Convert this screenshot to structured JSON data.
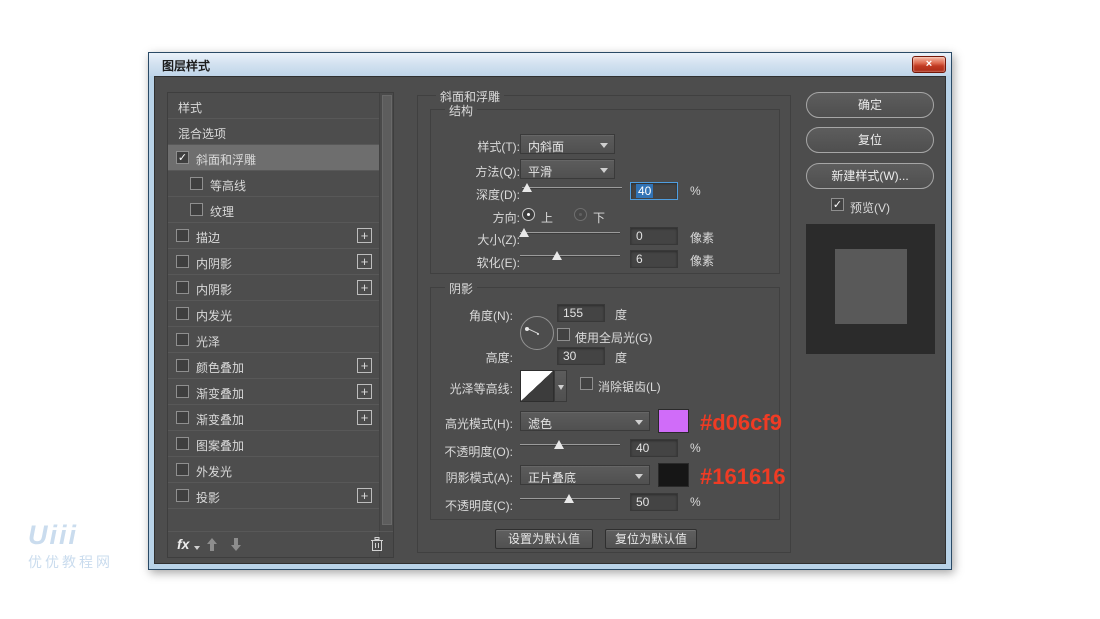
{
  "window": {
    "title": "图层样式",
    "close_label": "×"
  },
  "sidebar": {
    "items": [
      {
        "key": "styles",
        "label": "样式",
        "checkbox": false
      },
      {
        "key": "blending-options",
        "label": "混合选项",
        "checkbox": false
      },
      {
        "key": "bevel-emboss",
        "label": "斜面和浮雕",
        "checkbox": true,
        "checked": true,
        "selected": true
      },
      {
        "key": "contour",
        "label": "等高线",
        "checkbox": true,
        "indent": true
      },
      {
        "key": "texture",
        "label": "纹理",
        "checkbox": true,
        "indent": true
      },
      {
        "key": "stroke",
        "label": "描边",
        "checkbox": true,
        "plus": true
      },
      {
        "key": "inner-shadow-1",
        "label": "内阴影",
        "checkbox": true,
        "plus": true
      },
      {
        "key": "inner-shadow-2",
        "label": "内阴影",
        "checkbox": true,
        "plus": true
      },
      {
        "key": "inner-glow",
        "label": "内发光",
        "checkbox": true
      },
      {
        "key": "satin",
        "label": "光泽",
        "checkbox": true
      },
      {
        "key": "color-overlay",
        "label": "颜色叠加",
        "checkbox": true,
        "plus": true
      },
      {
        "key": "gradient-overlay-1",
        "label": "渐变叠加",
        "checkbox": true,
        "plus": true
      },
      {
        "key": "gradient-overlay-2",
        "label": "渐变叠加",
        "checkbox": true,
        "plus": true
      },
      {
        "key": "pattern-overlay",
        "label": "图案叠加",
        "checkbox": true
      },
      {
        "key": "outer-glow",
        "label": "外发光",
        "checkbox": true
      },
      {
        "key": "drop-shadow",
        "label": "投影",
        "checkbox": true,
        "plus": true
      }
    ],
    "footer": {
      "fx_label": "fx"
    }
  },
  "panel": {
    "title": "斜面和浮雕",
    "structure": {
      "title": "结构",
      "style_label": "样式(T):",
      "style_value": "内斜面",
      "technique_label": "方法(Q):",
      "technique_value": "平滑",
      "depth_label": "深度(D):",
      "depth_value": "40",
      "depth_unit": "%",
      "direction_label": "方向:",
      "dir_up": "上",
      "dir_down": "下",
      "size_label": "大小(Z):",
      "size_value": "0",
      "size_unit": "像素",
      "soften_label": "软化(E):",
      "soften_value": "6",
      "soften_unit": "像素"
    },
    "shading": {
      "title": "阴影",
      "angle_label": "角度(N):",
      "angle_value": "155",
      "angle_unit": "度",
      "global_light_label": "使用全局光(G)",
      "altitude_label": "高度:",
      "altitude_value": "30",
      "altitude_unit": "度",
      "gloss_label": "光泽等高线:",
      "antialias_label": "消除锯齿(L)",
      "highlight_label": "高光模式(H):",
      "highlight_value": "滤色",
      "highlight_color": "#d06cf9",
      "highlight_annotation": "#d06cf9",
      "h_opacity_label": "不透明度(O):",
      "h_opacity_value": "40",
      "h_opacity_unit": "%",
      "shadow_label": "阴影模式(A):",
      "shadow_value": "正片叠底",
      "shadow_color": "#161616",
      "shadow_annotation": "#161616",
      "s_opacity_label": "不透明度(C):",
      "s_opacity_value": "50",
      "s_opacity_unit": "%"
    },
    "buttons": {
      "set_default": "设置为默认值",
      "reset_default": "复位为默认值"
    }
  },
  "actions": {
    "ok": "确定",
    "reset": "复位",
    "new_style": "新建样式(W)...",
    "preview_label": "预览(V)",
    "preview_checked": true
  },
  "annotation_color": "#ef3b24",
  "watermark": {
    "logo": "Uiii",
    "name": "优优教程网"
  }
}
